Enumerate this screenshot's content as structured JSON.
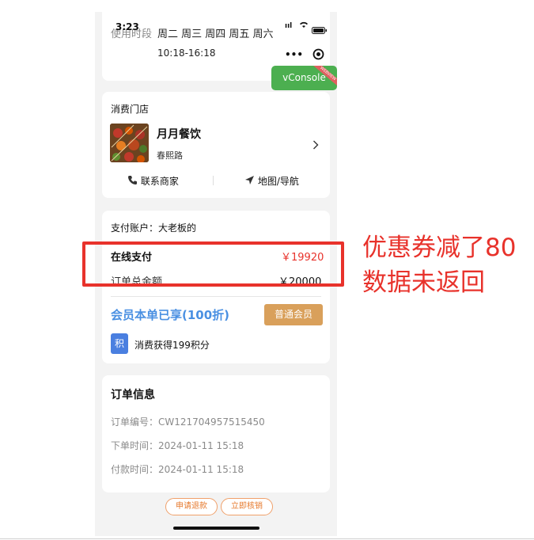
{
  "status_bar": {
    "time": "3:23"
  },
  "usage": {
    "label": "使用时段",
    "days": "周二 周三 周四 周五 周六",
    "hours": "10:18-16:18"
  },
  "capsule": {
    "more": "•••"
  },
  "vconsole": {
    "label": "vConsole",
    "tag": "WEBVIEW"
  },
  "store": {
    "section_label": "消费门店",
    "name": "月月餐饮",
    "address": "春熙路",
    "contact_label": "联系商家",
    "map_label": "地图/导航"
  },
  "payment": {
    "account": "支付账户：大老板的",
    "online_label": "在线支付",
    "online_amount": "￥19920",
    "total_label": "订单总金额",
    "total_amount": "￥20000",
    "member_text": "会员本单已享(100折)",
    "member_badge": "普通会员",
    "points_icon": "积",
    "points_text": "消费获得199积分"
  },
  "order": {
    "title": "订单信息",
    "number": "订单编号：CW121704957515450",
    "created": "下单时间：2024-01-11 15:18",
    "paid": "付款时间：2024-01-11 15:18"
  },
  "actions": {
    "refund": "申请退款",
    "verify": "立即核销"
  },
  "annotation": {
    "line1": "优惠券减了80",
    "line2": "数据未返回"
  },
  "colors": {
    "red": "#e8322b",
    "member_blue": "#4a90e2",
    "badge_orange": "#d9a05b",
    "vconsole_green": "#4caf50"
  }
}
